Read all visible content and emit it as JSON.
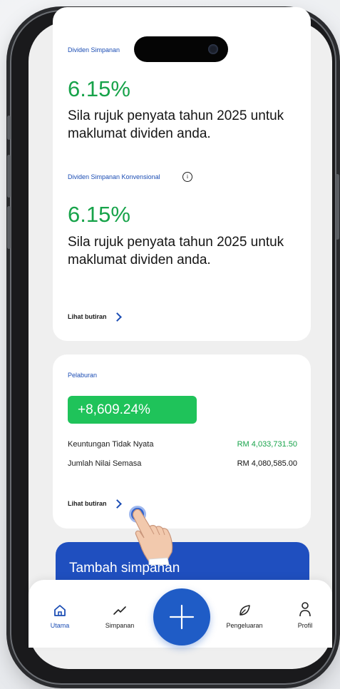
{
  "dividend": {
    "caption_top": "Dividen Simpanan",
    "rate_1": "6.15%",
    "note_1": "Sila rujuk penyata tahun 2025 untuk maklumat dividen anda.",
    "caption_conv": "Dividen Simpanan Konvensional",
    "rate_2": "6.15%",
    "note_2": "Sila rujuk penyata tahun 2025 untuk maklumat dividen anda.",
    "link": "Lihat butiran"
  },
  "investment": {
    "caption": "Pelaburan",
    "gain_pct": "+8,609.24%",
    "rows": [
      {
        "label": "Keuntungan Tidak Nyata",
        "value": "RM 4,033,731.50"
      },
      {
        "label": "Jumlah Nilai Semasa",
        "value": "RM 4,080,585.00"
      }
    ],
    "link": "Lihat butiran"
  },
  "add_savings": "Tambah simpanan",
  "nav": {
    "home": "Utama",
    "savings": "Simpanan",
    "spending": "Pengeluaran",
    "profile": "Profil"
  },
  "colors": {
    "accent": "#1f5cc6",
    "positive": "#17a34a",
    "badge": "#1fc35a"
  }
}
